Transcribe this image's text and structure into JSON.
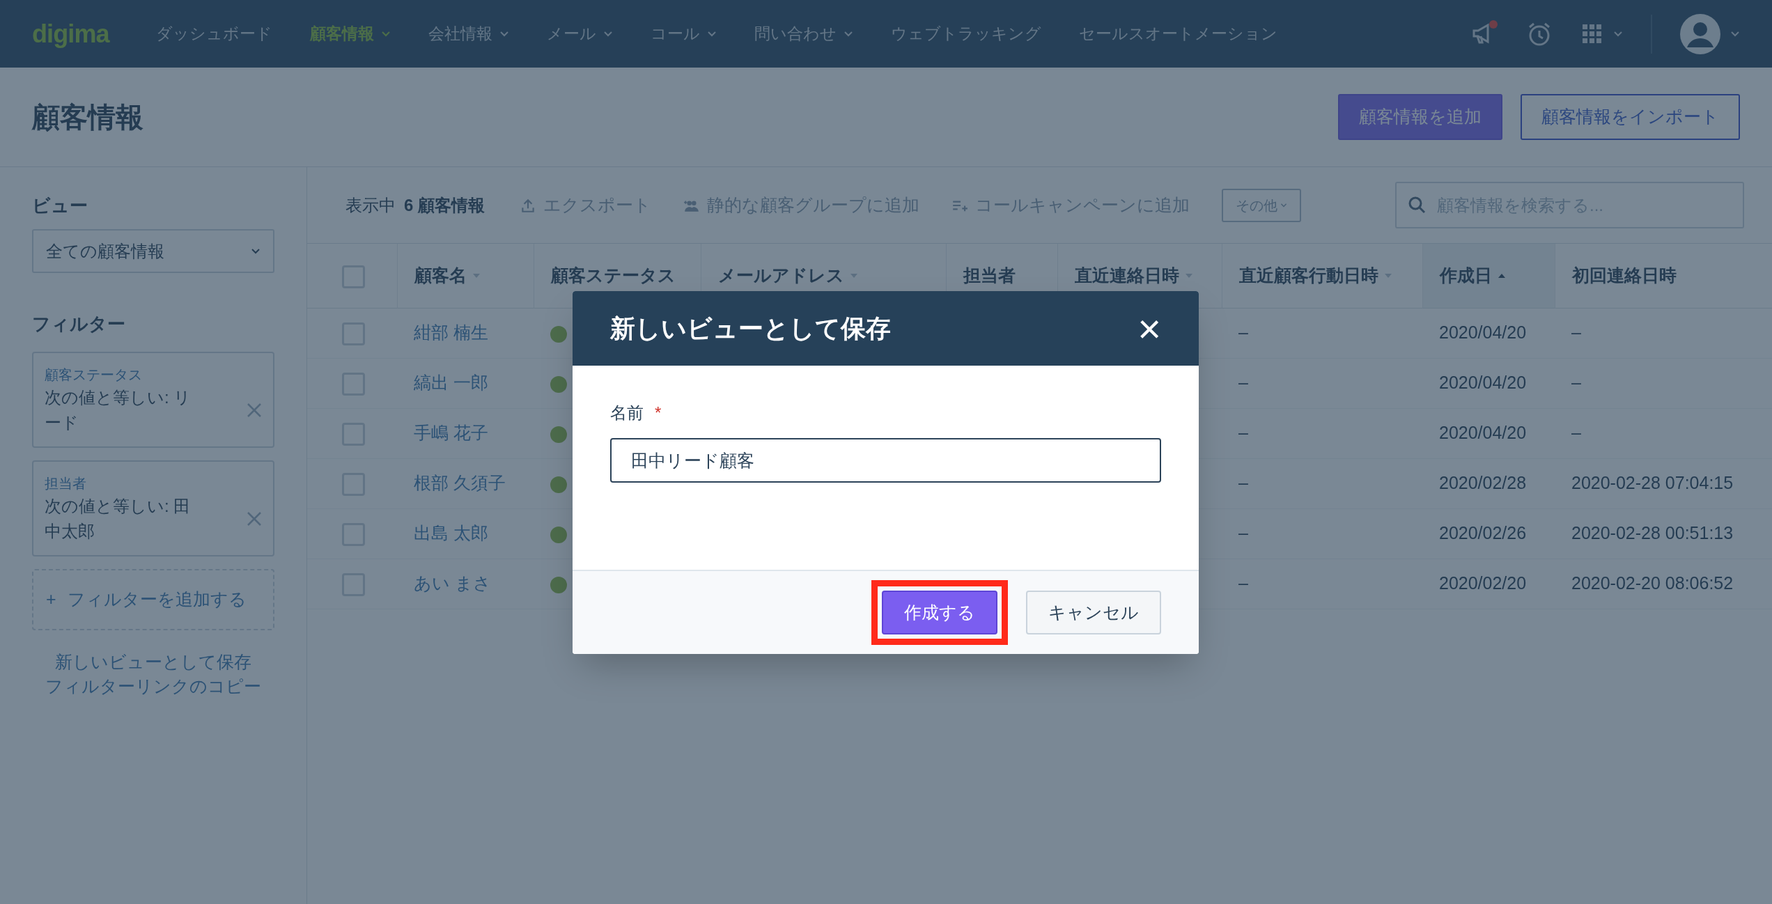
{
  "nav": {
    "logo": "digima",
    "items": [
      {
        "label": "ダッシュボード",
        "dropdown": false,
        "selected": false
      },
      {
        "label": "顧客情報",
        "dropdown": true,
        "selected": true
      },
      {
        "label": "会社情報",
        "dropdown": true,
        "selected": false
      },
      {
        "label": "メール",
        "dropdown": true,
        "selected": false
      },
      {
        "label": "コール",
        "dropdown": true,
        "selected": false
      },
      {
        "label": "問い合わせ",
        "dropdown": true,
        "selected": false
      },
      {
        "label": "ウェブトラッキング",
        "dropdown": false,
        "selected": false
      },
      {
        "label": "セールスオートメーション",
        "dropdown": false,
        "selected": false
      }
    ],
    "notification_dot": true
  },
  "page": {
    "title": "顧客情報",
    "buttons": [
      {
        "label": "顧客情報を追加",
        "kind": "primary"
      },
      {
        "label": "顧客情報をインポート",
        "kind": "outline"
      }
    ]
  },
  "sidebar": {
    "view_label": "ビュー",
    "view_select": "全ての顧客情報",
    "filter_label": "フィルター",
    "filters": [
      {
        "field": "顧客ステータス",
        "value": "次の値と等しい: リード"
      },
      {
        "field": "担当者",
        "value": "次の値と等しい: 田中太郎"
      }
    ],
    "add_filter": "フィルターを追加する",
    "add_filter_icon": "+",
    "links": [
      "新しいビューとして保存",
      "フィルターリンクのコピー"
    ]
  },
  "toolbar": {
    "count_prefix": "表示中",
    "count": "6 顧客情報",
    "actions": [
      {
        "label": "エクスポート",
        "kind": "export"
      },
      {
        "label": "静的な顧客グループに追加",
        "kind": "group"
      },
      {
        "label": "コールキャンペーンに追加",
        "kind": "list"
      }
    ],
    "more": "その他",
    "search_placeholder": "顧客情報を検索する..."
  },
  "table": {
    "select_all_checked": false,
    "columns": [
      {
        "label": "顧客名",
        "sortable": true,
        "sorted": false
      },
      {
        "label": "顧客ステータス",
        "sortable": false,
        "sorted": false
      },
      {
        "label": "メールアドレス",
        "sortable": true,
        "sorted": false
      },
      {
        "label": "担当者",
        "sortable": false,
        "sorted": false
      },
      {
        "label": "直近連絡日時",
        "sortable": true,
        "sorted": false
      },
      {
        "label": "直近顧客行動日時",
        "sortable": true,
        "sorted": false
      },
      {
        "label": "作成日",
        "sortable": true,
        "sorted": true
      },
      {
        "label": "初回連絡日時",
        "sortable": false,
        "sorted": false
      }
    ],
    "rows": [
      {
        "checked": false,
        "name": "紺部 楠生",
        "last_activity": "–",
        "created": "2020/04/20",
        "first_contact": "–"
      },
      {
        "checked": false,
        "name": "縞出 一郎",
        "last_activity": "–",
        "created": "2020/04/20",
        "first_contact": "–"
      },
      {
        "checked": false,
        "name": "手嶋 花子",
        "last_activity": "–",
        "created": "2020/04/20",
        "first_contact": "–"
      },
      {
        "checked": false,
        "name": "根部 久須子",
        "last_activity": "–",
        "created": "2020/02/28",
        "first_contact": "2020-02-28 07:04:15"
      },
      {
        "checked": false,
        "name": "出島 太郎",
        "last_activity": "–",
        "created": "2020/02/26",
        "first_contact": "2020-02-28 00:51:13"
      },
      {
        "checked": false,
        "name": "あい まさ",
        "last_activity": "–",
        "created": "2020/02/20",
        "first_contact": "2020-02-20 08:06:52"
      }
    ]
  },
  "dialog": {
    "title": "新しいビューとして保存",
    "close": "×",
    "field_label": "名前",
    "required_mark": "*",
    "field_value": "田中リード顧客",
    "buttons": [
      {
        "label": "作成する",
        "kind": "primary",
        "highlighted": true
      },
      {
        "label": "キャンセル",
        "kind": "secondary",
        "highlighted": false
      }
    ]
  }
}
